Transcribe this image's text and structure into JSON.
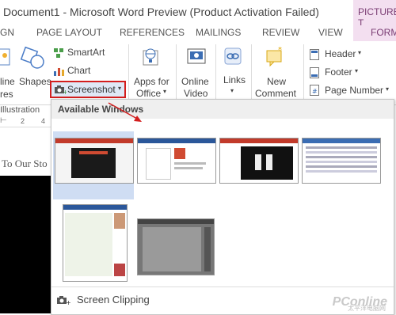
{
  "window": {
    "title": "Document1 - Microsoft Word Preview (Product Activation Failed)",
    "context_tab_group": "PICTURE T"
  },
  "tabs": {
    "items": [
      "GN",
      "PAGE LAYOUT",
      "REFERENCES",
      "MAILINGS",
      "REVIEW",
      "VIEW",
      "FORM"
    ]
  },
  "ribbon": {
    "online_pictures_partial": "line",
    "online_pictures_partial2": "res",
    "shapes": "Shapes",
    "smartart": "SmartArt",
    "chart": "Chart",
    "screenshot": "Screenshot",
    "apps_line1": "Apps for",
    "apps_line2": "Office",
    "online_video_line1": "Online",
    "online_video_line2": "Video",
    "links": "Links",
    "new_comment_line1": "New",
    "new_comment_line2": "Comment",
    "header": "Header",
    "footer": "Footer",
    "page_number": "Page Number",
    "group_illustrations": "Illustration"
  },
  "ruler": {
    "mark2": "2",
    "mark4": "4"
  },
  "document": {
    "text": "To Our Sto"
  },
  "screenshot_panel": {
    "header": "Available Windows",
    "screen_clipping": "Screen Clipping"
  },
  "watermark": {
    "brand": "PConline",
    "sub": "太平洋电脑网"
  },
  "colors": {
    "accent_red": "#d31e1e",
    "selection_blue": "#cfddf3",
    "context_pink": "#f3dff0"
  }
}
